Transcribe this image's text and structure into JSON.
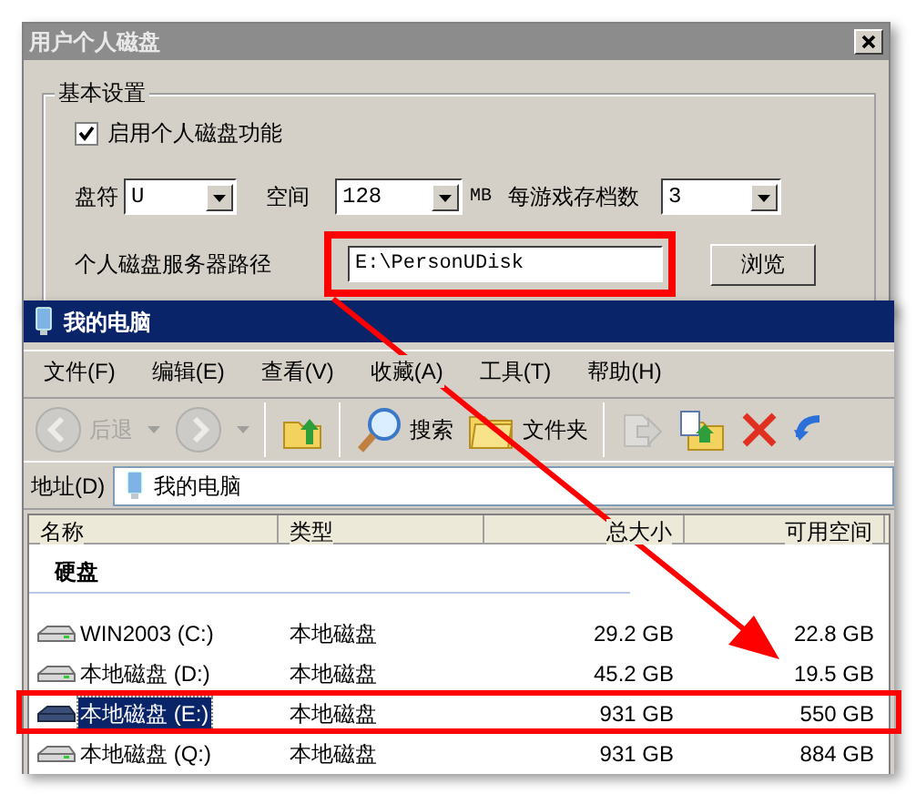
{
  "dialog": {
    "title": "用户个人磁盘",
    "group_title": "基本设置",
    "enable_checkbox": {
      "label": "启用个人磁盘功能",
      "checked": true
    },
    "drive_letter": {
      "label": "盘符",
      "value": "U"
    },
    "space": {
      "label": "空间",
      "value": "128",
      "unit": "MB"
    },
    "saves_per_game": {
      "label": "每游戏存档数",
      "value": "3"
    },
    "server_path": {
      "label": "个人磁盘服务器路径",
      "value": "E:\\PersonUDisk"
    },
    "browse_button": "浏览"
  },
  "explorer": {
    "title": "我的电脑",
    "menu": [
      "文件(F)",
      "编辑(E)",
      "查看(V)",
      "收藏(A)",
      "工具(T)",
      "帮助(H)"
    ],
    "toolbar": [
      {
        "kind": "back",
        "label": "后退",
        "disabled": true
      },
      {
        "kind": "forward",
        "disabled": true
      },
      {
        "kind": "up",
        "disabled": false
      },
      {
        "kind": "search",
        "label": "搜索",
        "disabled": false
      },
      {
        "kind": "folders",
        "label": "文件夹",
        "disabled": false
      },
      {
        "kind": "move",
        "disabled": true
      },
      {
        "kind": "copy",
        "disabled": false
      },
      {
        "kind": "delete",
        "disabled": false
      },
      {
        "kind": "undo",
        "disabled": false
      }
    ],
    "address": {
      "label": "地址(D)",
      "value": "我的电脑"
    },
    "columns": [
      "名称",
      "类型",
      "总大小",
      "可用空间"
    ],
    "group": "硬盘",
    "rows": [
      {
        "name": "WIN2003 (C:)",
        "type": "本地磁盘",
        "total": "29.2 GB",
        "free": "22.8 GB",
        "selected": false
      },
      {
        "name": "本地磁盘 (D:)",
        "type": "本地磁盘",
        "total": "45.2 GB",
        "free": "19.5 GB",
        "selected": false
      },
      {
        "name": "本地磁盘 (E:)",
        "type": "本地磁盘",
        "total": "931 GB",
        "free": "550 GB",
        "selected": true
      },
      {
        "name": "本地磁盘 (Q:)",
        "type": "本地磁盘",
        "total": "931 GB",
        "free": "884 GB",
        "selected": false
      }
    ]
  }
}
